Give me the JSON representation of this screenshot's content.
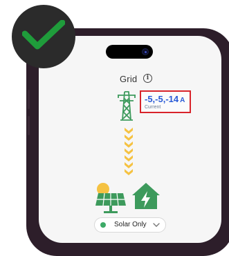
{
  "screen": {
    "title": "Grid",
    "info_icon": "info-icon",
    "grid_reading": {
      "value": "-5,-5,-14",
      "unit": "A",
      "label": "Current"
    },
    "icons": {
      "tower": "power-tower-icon",
      "flow": "chevron-down-flow-icon",
      "solar": "solar-panel-icon",
      "house": "house-lightning-icon"
    },
    "mode_selector": {
      "selected": "Solar Only",
      "status_color": "#3daa67"
    }
  },
  "overlay": {
    "badge_icon": "checkmark-icon",
    "badge_color": "#1f9c3b"
  },
  "colors": {
    "accent_blue": "#2a5bd7",
    "highlight_red": "#d8232a",
    "flow_yellow": "#f5c242",
    "icon_green": "#3d9a5c"
  }
}
